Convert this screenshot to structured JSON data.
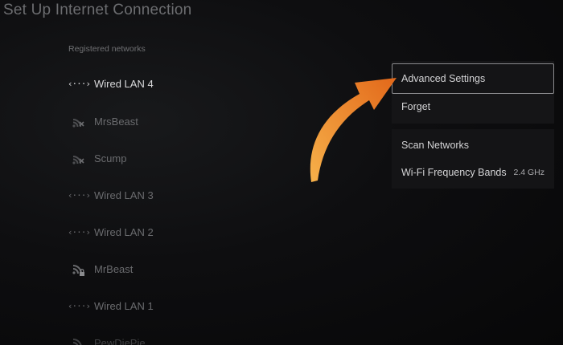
{
  "page": {
    "title": "Set Up Internet Connection",
    "section_label": "Registered networks"
  },
  "networks": [
    {
      "label": "Wired LAN 4",
      "type": "wired"
    },
    {
      "label": "MrsBeast",
      "type": "wifi-locked-unavailable"
    },
    {
      "label": "Scump",
      "type": "wifi-locked-unavailable"
    },
    {
      "label": "Wired LAN 3",
      "type": "wired"
    },
    {
      "label": "Wired LAN 2",
      "type": "wired"
    },
    {
      "label": "MrBeast",
      "type": "wifi-locked"
    },
    {
      "label": "Wired LAN 1",
      "type": "wired"
    },
    {
      "label": "PewDiePie",
      "type": "wifi"
    }
  ],
  "context_menu": {
    "items": [
      {
        "label": "Advanced Settings",
        "focused": true
      },
      {
        "label": "Forget"
      }
    ]
  },
  "options_menu": {
    "items": [
      {
        "label": "Scan Networks"
      },
      {
        "label": "Wi-Fi Frequency Bands",
        "value": "2.4 GHz"
      }
    ]
  },
  "colors": {
    "background": "#0b0b0c",
    "highlight_border": "#8a8a8d",
    "arrow_start": "#f7b14a",
    "arrow_end": "#e2681a"
  },
  "icons": {
    "wired": "wired-connection-icon",
    "wifi_locked": "wifi-lock-icon",
    "wifi_unavailable": "wifi-disconnected-icon",
    "annotation": "curved-arrow-icon"
  }
}
